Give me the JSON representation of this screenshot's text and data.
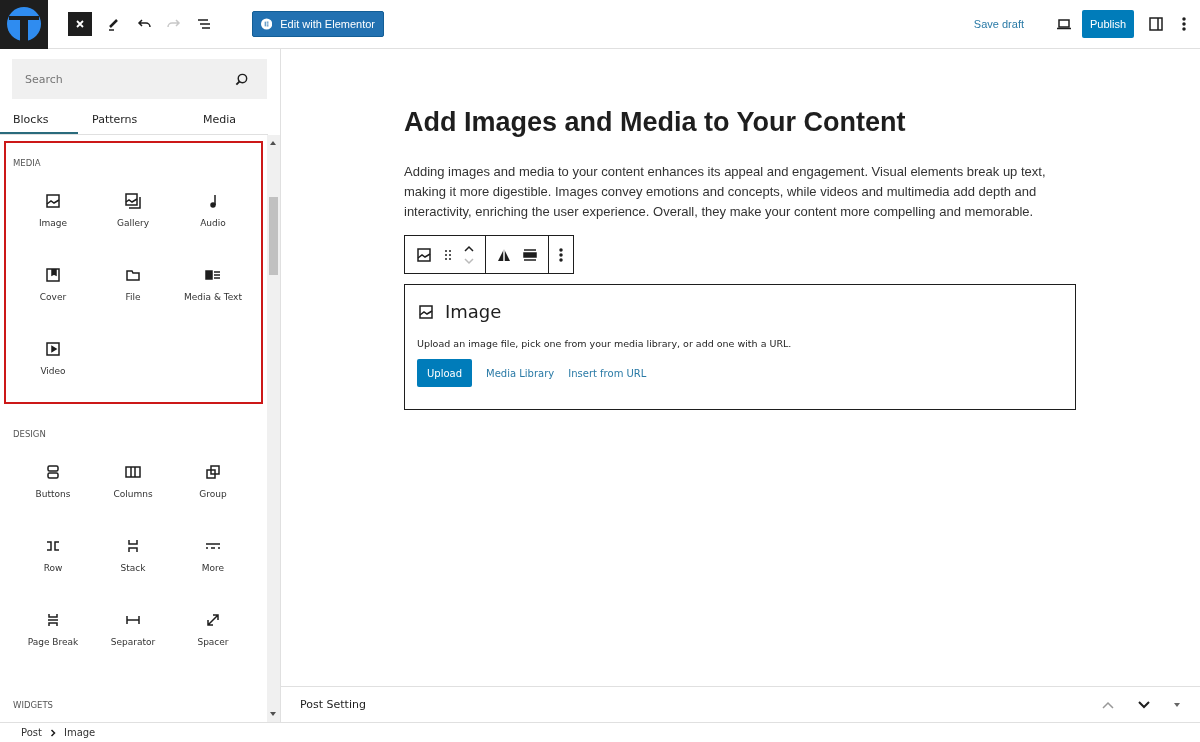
{
  "toolbar": {
    "redo_disabled": true,
    "elementor_button": "Edit with Elementor",
    "save_draft": "Save draft",
    "publish": "Publish"
  },
  "inserter": {
    "search": {
      "placeholder": "Search"
    },
    "tabs": [
      {
        "label": "Blocks",
        "selected": true
      },
      {
        "label": "Patterns",
        "selected": false
      },
      {
        "label": "Media",
        "selected": false
      }
    ],
    "sections": [
      {
        "title": "MEDIA",
        "highlighted": true,
        "items": [
          {
            "label": "Image"
          },
          {
            "label": "Gallery"
          },
          {
            "label": "Audio"
          },
          {
            "label": "Cover"
          },
          {
            "label": "File"
          },
          {
            "label": "Media & Text"
          },
          {
            "label": "Video"
          }
        ]
      },
      {
        "title": "DESIGN",
        "highlighted": false,
        "items": [
          {
            "label": "Buttons"
          },
          {
            "label": "Columns"
          },
          {
            "label": "Group"
          },
          {
            "label": "Row"
          },
          {
            "label": "Stack"
          },
          {
            "label": "More"
          },
          {
            "label": "Page Break"
          },
          {
            "label": "Separator"
          },
          {
            "label": "Spacer"
          }
        ]
      },
      {
        "title": "WIDGETS",
        "highlighted": false
      }
    ]
  },
  "editor": {
    "title": "Add Images and Media to Your Content",
    "paragraph": "Adding images and media to your content enhances its appeal and engagement. Visual elements break up text, making it more digestible. Images convey emotions and concepts, while videos and multimedia add depth and interactivity, enriching the user experience. Overall, they make your content more compelling and memorable.",
    "image_block": {
      "title": "Image",
      "instructions": "Upload an image file, pick one from your media library, or add one with a URL.",
      "upload": "Upload",
      "media_library": "Media Library",
      "insert_url": "Insert from URL"
    }
  },
  "post_setting": {
    "title": "Post Setting"
  },
  "breadcrumb": [
    {
      "label": "Post"
    },
    {
      "label": "Image"
    }
  ]
}
